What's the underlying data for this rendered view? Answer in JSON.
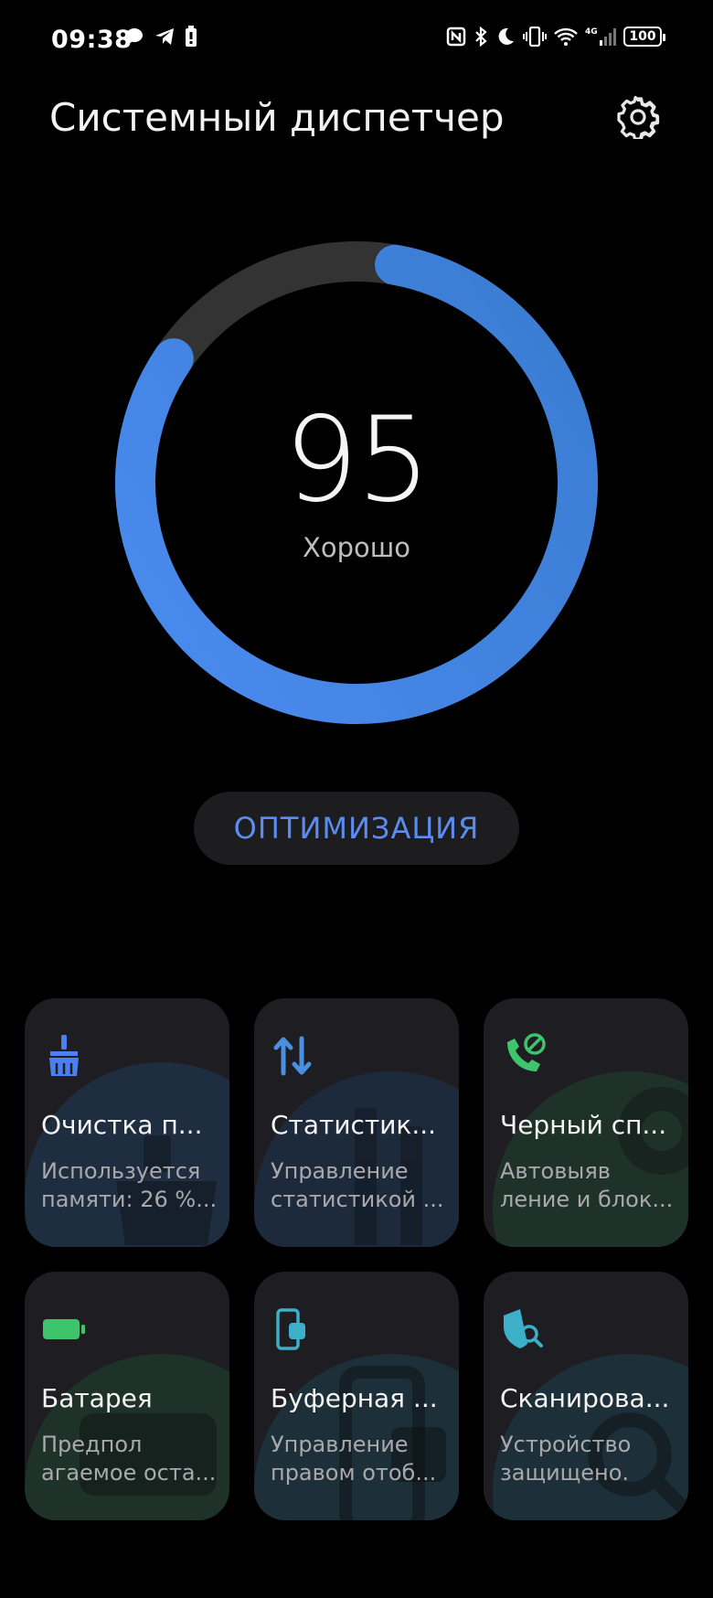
{
  "status_bar": {
    "time": "09:38",
    "battery": "100",
    "network": "4G",
    "icons": [
      "message-icon",
      "telegram-icon",
      "battery-saver-icon",
      "nfc-icon",
      "bluetooth-icon",
      "moon-icon",
      "vibrate-icon",
      "wifi-icon",
      "signal-icon",
      "battery-icon"
    ]
  },
  "header": {
    "title": "Системный диспетчер",
    "settings_icon": "gear-icon"
  },
  "score": {
    "value": "95",
    "label": "Хорошо",
    "ring_progress": 0.95,
    "ring_color": "#3f82e8",
    "track_color": "#333333"
  },
  "optimize_button": {
    "label": "ОПТИМИЗАЦИЯ",
    "color": "#5b8cf0"
  },
  "tiles": [
    {
      "title": "Очистка п...",
      "sub1": "Используется",
      "sub2": "памяти: 26 %...",
      "icon": "broom-icon",
      "color": "#4c7ff0"
    },
    {
      "title": "Статистик...",
      "sub1": "Управление",
      "sub2": "статистикой ...",
      "icon": "data-arrows-icon",
      "color": "#4a8fe0"
    },
    {
      "title": "Черный сп...",
      "sub1": "Автовыяв",
      "sub2": "ление и блок...",
      "icon": "blocked-call-icon",
      "color": "#3ec46d"
    },
    {
      "title": "Батарея",
      "sub1": "Предпол",
      "sub2": "агаемое оста...",
      "icon": "battery-icon",
      "color": "#3ec46d"
    },
    {
      "title": "Буферная ...",
      "sub1": "Управление",
      "sub2": "правом отоб...",
      "icon": "clipboard-phone-icon",
      "color": "#3bb0c8"
    },
    {
      "title": "Сканирова...",
      "sub1": "Устройство",
      "sub2": "защищено.",
      "icon": "shield-search-icon",
      "color": "#3bb0c8"
    }
  ]
}
